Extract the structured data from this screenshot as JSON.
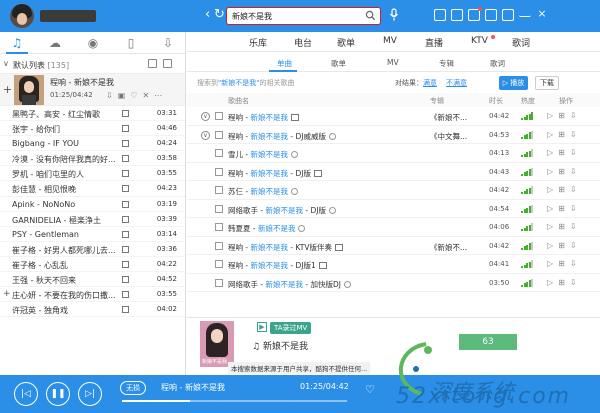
{
  "header": {
    "search_query": "新娘不是我",
    "colors": {
      "brand": "#2b8fe8",
      "search_border": "#cc2222"
    }
  },
  "categories": [
    "乐库",
    "电台",
    "歌单",
    "MV",
    "直播",
    "KTV",
    "歌词"
  ],
  "subtabs": [
    "单曲",
    "歌单",
    "MV",
    "专辑",
    "歌词"
  ],
  "info": {
    "prefix": "搜索到",
    "query_quoted": "\"新娘不是我\"",
    "suffix": "的相关歌曲",
    "compare_label": "对结果：",
    "option_satisfied": "满意",
    "option_unsatisfied": "不满意",
    "play_all": "播放",
    "download": "下载"
  },
  "table_headers": {
    "song": "歌曲名",
    "album": "专辑",
    "duration": "时长",
    "heat": "热度",
    "ops": "操作"
  },
  "results": [
    {
      "artist": "程响",
      "title": "新娘不是我",
      "extra": "",
      "album": "《新娘不...",
      "duration": "04:42",
      "expand": true,
      "heat": 5
    },
    {
      "artist": "程响",
      "title": "新娘不是我",
      "extra": " - DJ威威版",
      "album": "《中文舞...",
      "duration": "04:53",
      "expand": true,
      "heat": 4
    },
    {
      "artist": "雪儿",
      "title": "新娘不是我",
      "extra": "",
      "album": "",
      "duration": "04:13",
      "expand": false,
      "heat": 4
    },
    {
      "artist": "程响",
      "title": "新娘不是我",
      "extra": " - DJ版",
      "album": "",
      "duration": "04:43",
      "expand": false,
      "heat": 4
    },
    {
      "artist": "苏仨",
      "title": "新娘不是我",
      "extra": "",
      "album": "",
      "duration": "04:42",
      "expand": false,
      "heat": 4
    },
    {
      "artist": "网络歌手",
      "title": "新娘不是我",
      "extra": " - DJ版",
      "album": "",
      "duration": "04:54",
      "expand": false,
      "heat": 4
    },
    {
      "artist": "韩夏夏",
      "title": "新娘不是我",
      "extra": "",
      "album": "",
      "duration": "04:06",
      "expand": false,
      "heat": 4
    },
    {
      "artist": "程响",
      "title": "新娘不是我",
      "extra": " - KTV版伴奏",
      "album": "《新娘不...",
      "duration": "04:42",
      "expand": false,
      "heat": 4
    },
    {
      "artist": "程响",
      "title": "新娘不是我",
      "extra": " - DJ版1",
      "album": "",
      "duration": "04:41",
      "expand": false,
      "heat": 4
    },
    {
      "artist": "网络歌手",
      "title": "新娘不是我",
      "extra": " - 加快版DJ",
      "album": "",
      "duration": "03:50",
      "expand": false,
      "heat": 4
    }
  ],
  "bottom_info": {
    "mv_label": "TA录过MV",
    "song_title": "新娘不是我",
    "count": "63",
    "note": "本搜索数据来源于用户共享，酷狗不提供任何..."
  },
  "left_panel": {
    "list_title": "默认列表",
    "list_count": "[135]",
    "now_playing": {
      "title": "程响 - 新娘不是我",
      "time": "01:25/04:42"
    },
    "songs": [
      {
        "name": "黑鸭子、高安 - 红尘情歌",
        "duration": "03:31"
      },
      {
        "name": "张宇 - 给你们",
        "duration": "04:46"
      },
      {
        "name": "Bigbang - IF YOU",
        "duration": "04:24"
      },
      {
        "name": "冷漠 - 没有你陪伴我真的好...",
        "duration": "03:58"
      },
      {
        "name": "罗机 - 咱们屯里的人",
        "duration": "03:55"
      },
      {
        "name": "彭佳慧 - 相见恨晚",
        "duration": "04:23"
      },
      {
        "name": "Apink - NoNoNo",
        "duration": "03:19"
      },
      {
        "name": "GARNIDELIA - 極楽浄土",
        "duration": "03:39"
      },
      {
        "name": "PSY - Gentleman",
        "duration": "03:14"
      },
      {
        "name": "崔子格 - 好男人都死哪儿去...",
        "duration": "03:36"
      },
      {
        "name": "崔子格 - 心乱乱",
        "duration": "04:22"
      },
      {
        "name": "王强 - 秋天不回来",
        "duration": "04:52"
      },
      {
        "name": "庄心妍 - 不要在我的伤口撒...",
        "duration": "03:55"
      },
      {
        "name": "许冠英 - 独角戏",
        "duration": "04:02"
      }
    ]
  },
  "playbar": {
    "mode": "无损",
    "title": "程响 - 新娘不是我",
    "time": "01:25/04:42",
    "progress": 0.3
  },
  "watermark": {
    "text": "52xitong.com",
    "sub": "深度系统"
  }
}
